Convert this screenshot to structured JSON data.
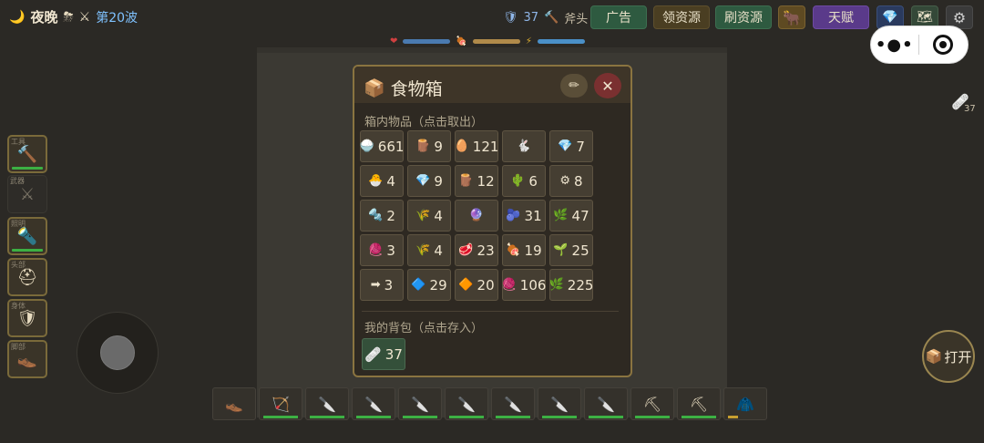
{
  "topbar": {
    "moon_icon": "🌙",
    "night_label": "夜晚",
    "weather_icon": "⛈",
    "swords_icon": "⚔",
    "wave_label": "第20波",
    "defense_icon": "🛡",
    "defense_value": "37",
    "weapon_icon": "🔨",
    "weapon_label": "斧头",
    "ad_label": "广告",
    "claim_label": "领资源",
    "refresh_label": "刷资源",
    "cow_icon": "🐂",
    "talent_label": "天赋",
    "gem_icon": "💎",
    "map_icon": "🗺",
    "gear_icon": "⚙"
  },
  "status": {
    "heart_icon": "❤",
    "food_icon": "🍖",
    "energy_icon": "⚡",
    "heart_color": "#4a7ab0",
    "food_color": "#b08a4a",
    "energy_color": "#4a90c8",
    "heart_level": 1.0,
    "food_level": 1.0,
    "energy_level": 1.0
  },
  "capsule": {
    "dots": "•●•"
  },
  "ground": {
    "icon": "🩹",
    "count": "37"
  },
  "equipment": [
    {
      "label": "工具",
      "icon": "🔨",
      "empty": false,
      "durability": 1.0
    },
    {
      "label": "武器",
      "icon": "⚔",
      "empty": true,
      "durability": 0
    },
    {
      "label": "照明",
      "icon": "🔦",
      "empty": false,
      "durability": 1.0
    },
    {
      "label": "头部",
      "icon": "⛑",
      "empty": false,
      "durability": 0
    },
    {
      "label": "身体",
      "icon": "🛡",
      "empty": false,
      "durability": 0
    },
    {
      "label": "脚部",
      "icon": "👞",
      "empty": false,
      "durability": 0
    }
  ],
  "open_button": {
    "icon": "📦",
    "label": "打开"
  },
  "hotbar": [
    {
      "icon": "👞",
      "durability": 0
    },
    {
      "icon": "🏹",
      "durability": 1.0
    },
    {
      "icon": "🔪",
      "durability": 1.0
    },
    {
      "icon": "🔪",
      "durability": 1.0
    },
    {
      "icon": "🔪",
      "durability": 1.0
    },
    {
      "icon": "🔪",
      "durability": 1.0
    },
    {
      "icon": "🔪",
      "durability": 1.0
    },
    {
      "icon": "🔪",
      "durability": 1.0
    },
    {
      "icon": "🔪",
      "durability": 1.0
    },
    {
      "icon": "⛏",
      "durability": 1.0
    },
    {
      "icon": "⛏",
      "durability": 1.0
    },
    {
      "icon": "🧥",
      "durability": 0.3
    }
  ],
  "dialog": {
    "title_icon": "📦",
    "title": "食物箱",
    "edit_icon": "✏",
    "close_icon": "✕",
    "box_label": "箱内物品（点击取出）",
    "bag_label": "我的背包（点击存入）",
    "box_items": [
      {
        "icon": "🍚",
        "count": "661"
      },
      {
        "icon": "🪵",
        "count": "9"
      },
      {
        "icon": "🥚",
        "count": "121"
      },
      {
        "icon": "🐇",
        "count": ""
      },
      {
        "icon": "💎",
        "count": "7"
      },
      {
        "icon": "🐣",
        "count": "4"
      },
      {
        "icon": "💎",
        "count": "9"
      },
      {
        "icon": "🪵",
        "count": "12"
      },
      {
        "icon": "🌵",
        "count": "6"
      },
      {
        "icon": "⚙",
        "count": "8"
      },
      {
        "icon": "🔩",
        "count": "2"
      },
      {
        "icon": "🌾",
        "count": "4"
      },
      {
        "icon": "🔮",
        "count": ""
      },
      {
        "icon": "🫐",
        "count": "31"
      },
      {
        "icon": "🌿",
        "count": "47"
      },
      {
        "icon": "🧶",
        "count": "3"
      },
      {
        "icon": "🌾",
        "count": "4"
      },
      {
        "icon": "🥩",
        "count": "23"
      },
      {
        "icon": "🍖",
        "count": "19"
      },
      {
        "icon": "🌱",
        "count": "25"
      },
      {
        "icon": "➡",
        "count": "3"
      },
      {
        "icon": "🔷",
        "count": "29"
      },
      {
        "icon": "🔶",
        "count": "20"
      },
      {
        "icon": "🧶",
        "count": "106"
      },
      {
        "icon": "🌿",
        "count": "225"
      }
    ],
    "bag_items": [
      {
        "icon": "🩹",
        "count": "37"
      }
    ]
  }
}
